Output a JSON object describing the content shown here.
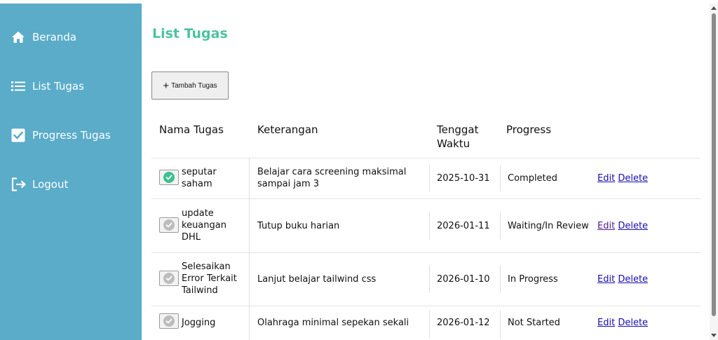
{
  "sidebar": {
    "items": [
      {
        "label": "Beranda",
        "icon": "home-icon"
      },
      {
        "label": "List Tugas",
        "icon": "list-icon"
      },
      {
        "label": "Progress Tugas",
        "icon": "checkbox-icon"
      },
      {
        "label": "Logout",
        "icon": "logout-icon"
      }
    ],
    "background": "#5aacc8"
  },
  "page": {
    "title": "List Tugas",
    "title_color": "#4cc3a0",
    "add_button_label": "Tambah Tugas"
  },
  "table": {
    "headers": [
      "Nama Tugas",
      "Keterangan",
      "Tenggat Waktu",
      "Progress"
    ],
    "rows": [
      {
        "name": "seputar saham",
        "description": "Belajar cara screening maksimal sampai jam 3",
        "deadline": "2025-10-31",
        "progress": "Completed",
        "done": true
      },
      {
        "name": "update keuangan DHL",
        "description": "Tutup buku harian",
        "deadline": "2026-01-11",
        "progress": "Waiting/In Review",
        "done": false
      },
      {
        "name": "Selesaikan Error Terkait Tailwind",
        "description": "Lanjut belajar tailwind css",
        "deadline": "2026-01-10",
        "progress": "In Progress",
        "done": false
      },
      {
        "name": "Jogging",
        "description": "Olahraga minimal sepekan sekali",
        "deadline": "2026-01-12",
        "progress": "Not Started",
        "done": false
      }
    ],
    "edit_label": "Edit",
    "delete_label": "Delete",
    "done_color": "#3cc08f",
    "pending_color": "#bdbdbd"
  }
}
